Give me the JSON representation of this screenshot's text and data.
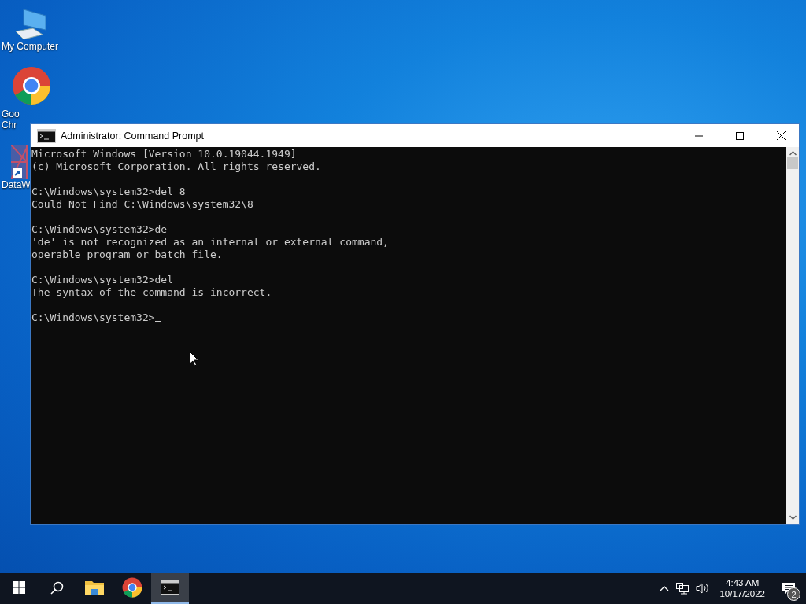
{
  "desktop_icons": [
    {
      "kind": "computer",
      "label_lines": [
        "My Computer"
      ]
    },
    {
      "kind": "chrome",
      "label_lines": [
        "Goo",
        "Chr"
      ]
    },
    {
      "kind": "data",
      "label_lines": [
        "DataW"
      ]
    }
  ],
  "window": {
    "title": "Administrator: Command Prompt",
    "blocks": [
      [
        "Microsoft Windows [Version 10.0.19044.1949]",
        "(c) Microsoft Corporation. All rights reserved."
      ],
      [
        "C:\\Windows\\system32>del 8",
        "Could Not Find C:\\Windows\\system32\\8"
      ],
      [
        "C:\\Windows\\system32>de",
        "'de' is not recognized as an internal or external command,",
        "operable program or batch file."
      ],
      [
        "C:\\Windows\\system32>del",
        "The syntax of the command is incorrect."
      ],
      [
        "C:\\Windows\\system32>"
      ]
    ]
  },
  "taskbar": {
    "items": [
      {
        "kind": "start",
        "selected": false
      },
      {
        "kind": "search",
        "selected": false
      },
      {
        "kind": "explorer",
        "selected": false
      },
      {
        "kind": "chrome",
        "selected": false
      },
      {
        "kind": "cmd",
        "selected": true
      }
    ],
    "clock": {
      "time": "4:43 AM",
      "date": "10/17/2022"
    },
    "notifications": {
      "count": "2"
    }
  }
}
